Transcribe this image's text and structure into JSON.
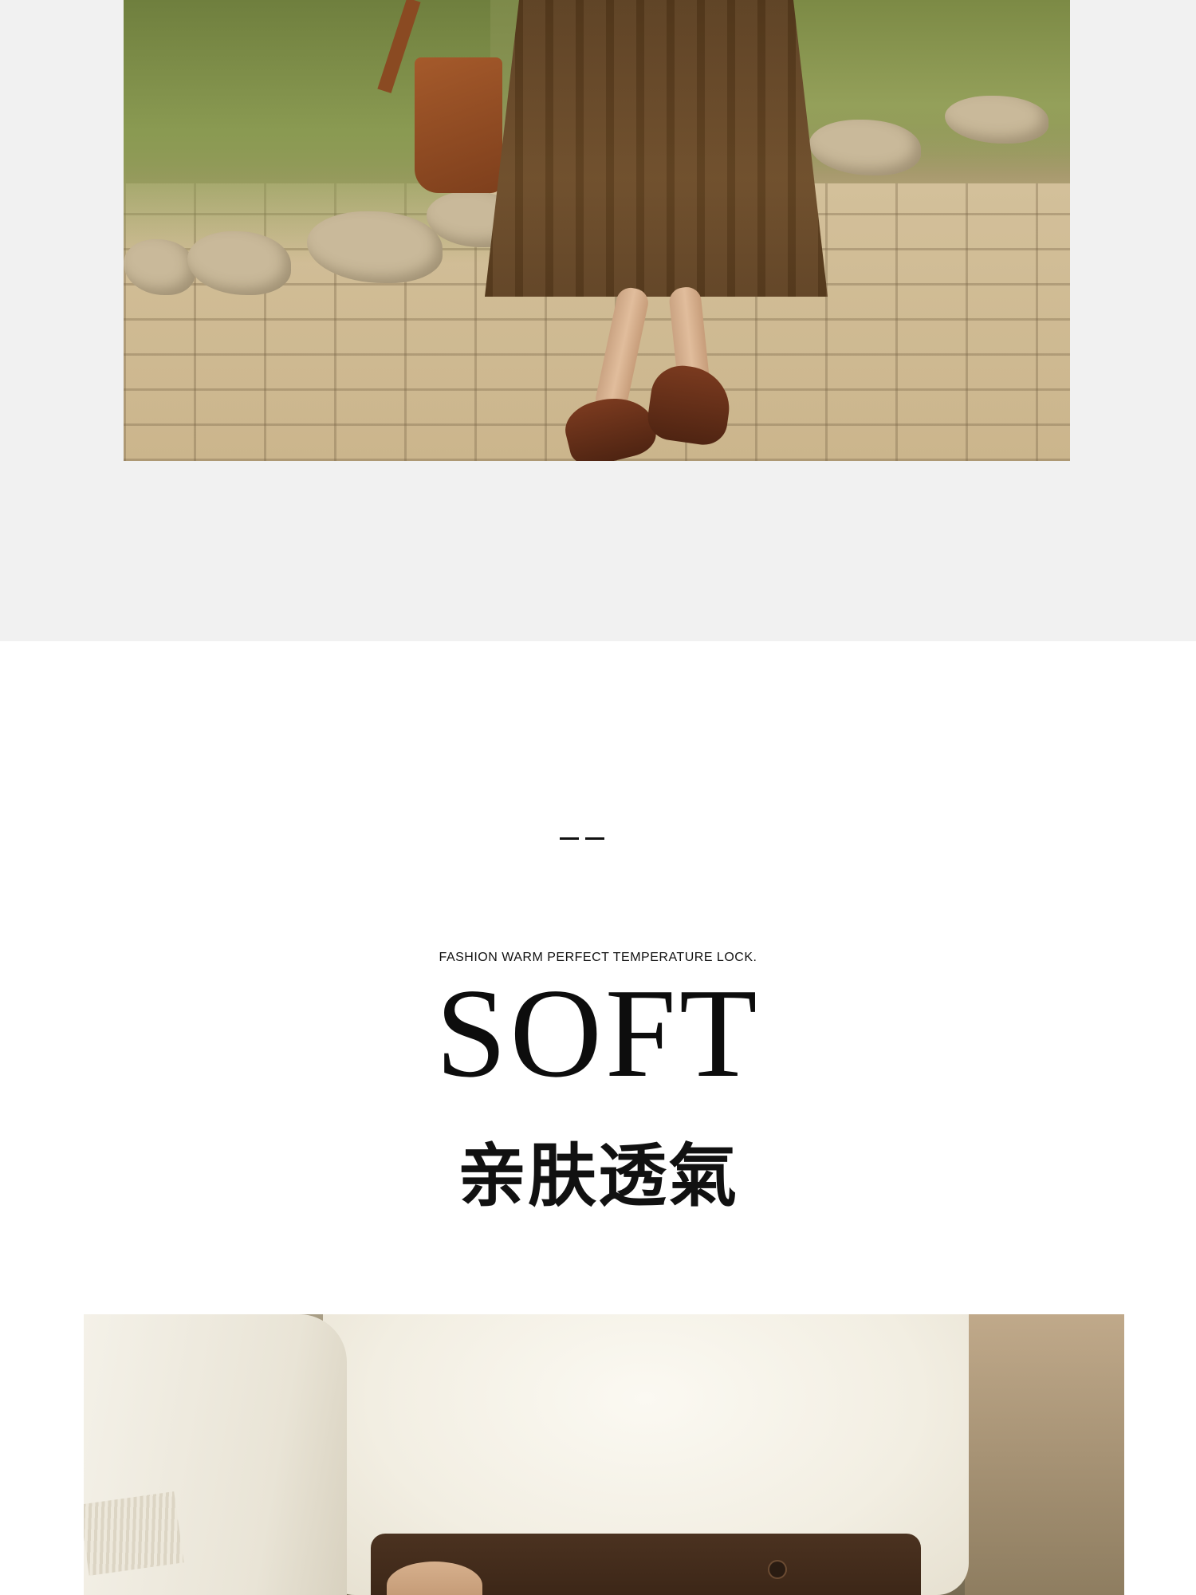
{
  "hero_photo": {
    "description_icon": "photo-skirt-loafers-cobblestone"
  },
  "section": {
    "dash_icon": "double-dash-divider",
    "tagline": "FASHION WARM PERFECT TEMPERATURE LOCK.",
    "headline": "SOFT",
    "subtitle": "亲肤透氣"
  },
  "detail_photo": {
    "description_icon": "photo-cream-sweater-brown-trousers"
  },
  "colors": {
    "top_band": "#f1f1f1",
    "page_background": "#ffffff",
    "text": "#111111"
  }
}
